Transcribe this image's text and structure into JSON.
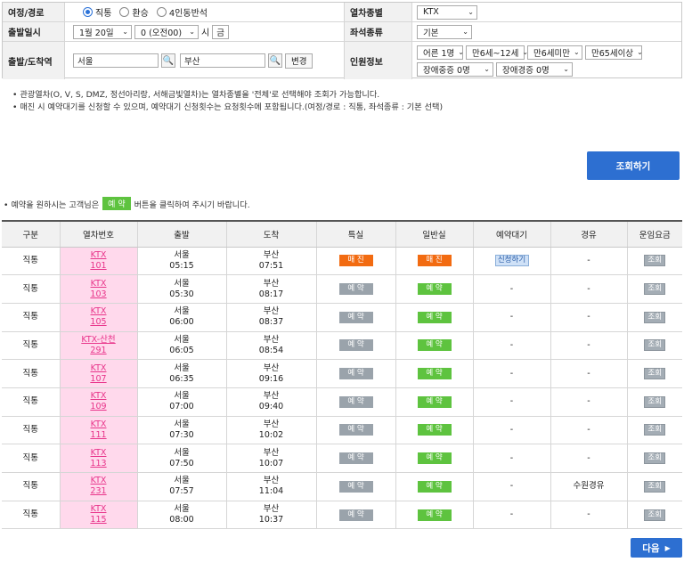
{
  "form": {
    "route": {
      "label": "여정/경로",
      "options": [
        "직통",
        "환승",
        "4인동반석"
      ],
      "selected_index": 0
    },
    "departure_datetime": {
      "label": "출발일시",
      "date": "1월 20일",
      "time": "0 (오전00)",
      "hour_suffix": "시",
      "weekday": "금"
    },
    "stations": {
      "label": "출발/도착역",
      "origin": "서울",
      "destination": "부산",
      "change_label": "변경"
    },
    "train_type": {
      "label": "열차종별",
      "value": "KTX"
    },
    "seat_type": {
      "label": "좌석종류",
      "value": "기본"
    },
    "passengers": {
      "label": "인원정보",
      "row1": [
        "어른 1명",
        "만6세~12세",
        "만6세미만",
        "만65세이상"
      ],
      "row2": [
        "장애중증 0명",
        "장애경증 0명"
      ]
    }
  },
  "notes": [
    "관광열차(O, V, S, DMZ, 정선아리랑, 서해금빛열차)는 열차종별을 '전체'로 선택해야 조회가 가능합니다.",
    "매진 시 예약대기를 신청할 수 있으며, 예약대기 신청횟수는 요청횟수에 포함됩니다.(여정/경로 : 직통, 좌석종류 : 기본 선택)"
  ],
  "search_button": "조회하기",
  "hint": {
    "before": "• 예약을 원하시는 고객님은",
    "chip": "예 약",
    "after": "버튼을 클릭하여 주시기 바랍니다."
  },
  "table": {
    "headers": [
      "구분",
      "열차번호",
      "출발",
      "도착",
      "특실",
      "일반실",
      "예약대기",
      "경유",
      "운임요금"
    ],
    "rows": [
      {
        "type": "직통",
        "train_name": "KTX",
        "train_no": "101",
        "dep_station": "서울",
        "dep_time": "05:15",
        "arr_station": "부산",
        "arr_time": "07:51",
        "special": "매 진",
        "general": "매 진",
        "waitlist": "신청하기",
        "via": "-",
        "fare": "조회"
      },
      {
        "type": "직통",
        "train_name": "KTX",
        "train_no": "103",
        "dep_station": "서울",
        "dep_time": "05:30",
        "arr_station": "부산",
        "arr_time": "08:17",
        "special": "예 약",
        "general": "예 약",
        "waitlist": "-",
        "via": "-",
        "fare": "조회"
      },
      {
        "type": "직통",
        "train_name": "KTX",
        "train_no": "105",
        "dep_station": "서울",
        "dep_time": "06:00",
        "arr_station": "부산",
        "arr_time": "08:37",
        "special": "예 약",
        "general": "예 약",
        "waitlist": "-",
        "via": "-",
        "fare": "조회"
      },
      {
        "type": "직통",
        "train_name": "KTX-산천",
        "train_no": "291",
        "dep_station": "서울",
        "dep_time": "06:05",
        "arr_station": "부산",
        "arr_time": "08:54",
        "special": "예 약",
        "general": "예 약",
        "waitlist": "-",
        "via": "-",
        "fare": "조회"
      },
      {
        "type": "직통",
        "train_name": "KTX",
        "train_no": "107",
        "dep_station": "서울",
        "dep_time": "06:35",
        "arr_station": "부산",
        "arr_time": "09:16",
        "special": "예 약",
        "general": "예 약",
        "waitlist": "-",
        "via": "-",
        "fare": "조회"
      },
      {
        "type": "직통",
        "train_name": "KTX",
        "train_no": "109",
        "dep_station": "서울",
        "dep_time": "07:00",
        "arr_station": "부산",
        "arr_time": "09:40",
        "special": "예 약",
        "general": "예 약",
        "waitlist": "-",
        "via": "-",
        "fare": "조회"
      },
      {
        "type": "직통",
        "train_name": "KTX",
        "train_no": "111",
        "dep_station": "서울",
        "dep_time": "07:30",
        "arr_station": "부산",
        "arr_time": "10:02",
        "special": "예 약",
        "general": "예 약",
        "waitlist": "-",
        "via": "-",
        "fare": "조회"
      },
      {
        "type": "직통",
        "train_name": "KTX",
        "train_no": "113",
        "dep_station": "서울",
        "dep_time": "07:50",
        "arr_station": "부산",
        "arr_time": "10:07",
        "special": "예 약",
        "general": "예 약",
        "waitlist": "-",
        "via": "-",
        "fare": "조회"
      },
      {
        "type": "직통",
        "train_name": "KTX",
        "train_no": "231",
        "dep_station": "서울",
        "dep_time": "07:57",
        "arr_station": "부산",
        "arr_time": "11:04",
        "special": "예 약",
        "general": "예 약",
        "waitlist": "-",
        "via": "수원경유",
        "fare": "조회"
      },
      {
        "type": "직통",
        "train_name": "KTX",
        "train_no": "115",
        "dep_station": "서울",
        "dep_time": "08:00",
        "arr_station": "부산",
        "arr_time": "10:37",
        "special": "예 약",
        "general": "예 약",
        "waitlist": "-",
        "via": "-",
        "fare": "조회"
      }
    ]
  },
  "next_button": "다음",
  "colors": {
    "primary_blue": "#2d6fd1",
    "soldout_orange": "#f26b11",
    "reserve_green": "#5ec33f",
    "reserve_gray": "#9aa3ab",
    "train_no_pink": "#e8348a",
    "train_no_cell_bg": "#ffd9ec"
  }
}
